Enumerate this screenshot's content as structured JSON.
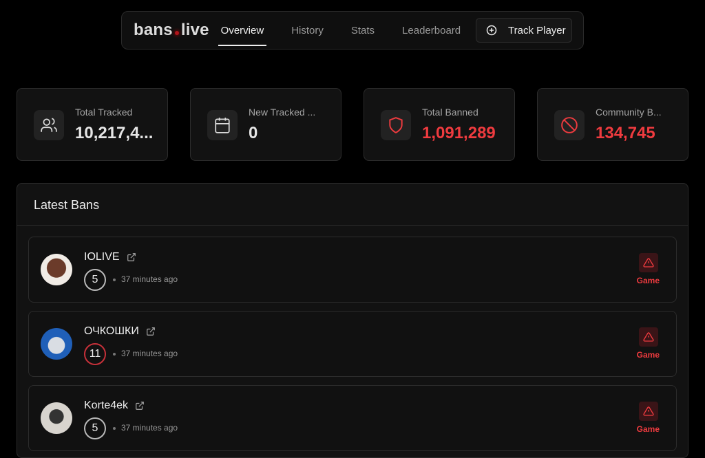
{
  "nav": {
    "logo_left": "bans",
    "logo_right": "live",
    "tabs": [
      "Overview",
      "History",
      "Stats",
      "Leaderboard"
    ],
    "track_label": "Track Player"
  },
  "stats": [
    {
      "label": "Total Tracked",
      "value": "10,217,4..."
    },
    {
      "label": "New Tracked ...",
      "value": "0"
    },
    {
      "label": "Total Banned",
      "value": "1,091,289"
    },
    {
      "label": "Community B...",
      "value": "134,745"
    }
  ],
  "latest": {
    "title": "Latest Bans",
    "items": [
      {
        "name": "IOLIVE",
        "count": "5",
        "time": "37 minutes ago",
        "type": "Game"
      },
      {
        "name": "ОЧКОШКИ",
        "count": "11",
        "time": "37 minutes ago",
        "type": "Game"
      },
      {
        "name": "Korte4ek",
        "count": "5",
        "time": "37 minutes ago",
        "type": "Game"
      }
    ]
  },
  "colors": {
    "accent": "#ef3b3f"
  }
}
